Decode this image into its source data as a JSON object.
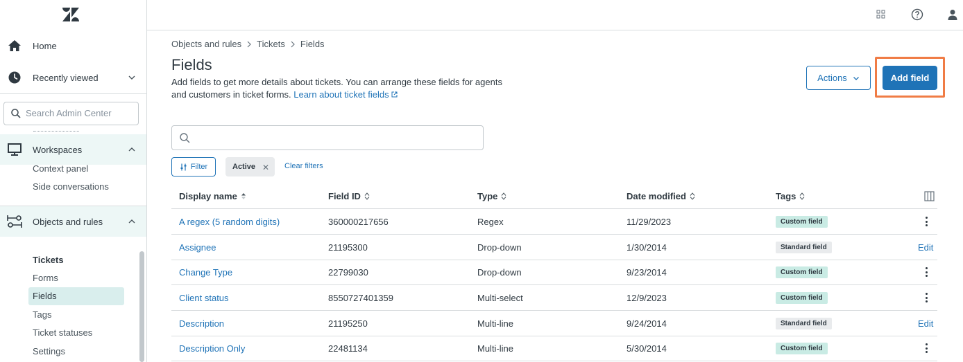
{
  "sidebar": {
    "home_label": "Home",
    "recently_viewed_label": "Recently viewed",
    "search_placeholder": "Search Admin Center",
    "workspaces_label": "Workspaces",
    "workspaces_items": [
      "Context panel",
      "Side conversations"
    ],
    "objects_label": "Objects and rules",
    "tickets_heading": "Tickets",
    "tickets_items": [
      "Forms",
      "Fields",
      "Tags",
      "Ticket statuses",
      "Settings"
    ]
  },
  "breadcrumb": [
    "Objects and rules",
    "Tickets",
    "Fields"
  ],
  "page": {
    "title": "Fields",
    "description": "Add fields to get more details about tickets. You can arrange these fields for agents and customers in ticket forms.",
    "learn_link": "Learn about ticket fields"
  },
  "actions_label": "Actions",
  "add_field_label": "Add field",
  "filter_label": "Filter",
  "active_chip": "Active",
  "clear_filters_label": "Clear filters",
  "table": {
    "headers": [
      "Display name",
      "Field ID",
      "Type",
      "Date modified",
      "Tags"
    ],
    "rows": [
      {
        "name": "A regex (5 random digits)",
        "id": "360000217656",
        "type": "Regex",
        "date": "11/29/2023",
        "tag": "Custom field",
        "action": "menu"
      },
      {
        "name": "Assignee",
        "id": "21195300",
        "type": "Drop-down",
        "date": "1/30/2014",
        "tag": "Standard field",
        "action": "Edit"
      },
      {
        "name": "Change Type",
        "id": "22799030",
        "type": "Drop-down",
        "date": "9/23/2014",
        "tag": "Custom field",
        "action": "menu"
      },
      {
        "name": "Client status",
        "id": "8550727401359",
        "type": "Multi-select",
        "date": "12/9/2023",
        "tag": "Custom field",
        "action": "menu"
      },
      {
        "name": "Description",
        "id": "21195250",
        "type": "Multi-line",
        "date": "9/24/2014",
        "tag": "Standard field",
        "action": "Edit"
      },
      {
        "name": "Description Only",
        "id": "22481134",
        "type": "Multi-line",
        "date": "5/30/2014",
        "tag": "Custom field",
        "action": "menu"
      }
    ]
  },
  "colors": {
    "primary": "#1f73b7",
    "highlight_outline": "#f07c45",
    "custom_tag_bg": "#c9ebe4",
    "standard_tag_bg": "#e9ebed",
    "nav_selected_bg": "#d9eeed"
  }
}
